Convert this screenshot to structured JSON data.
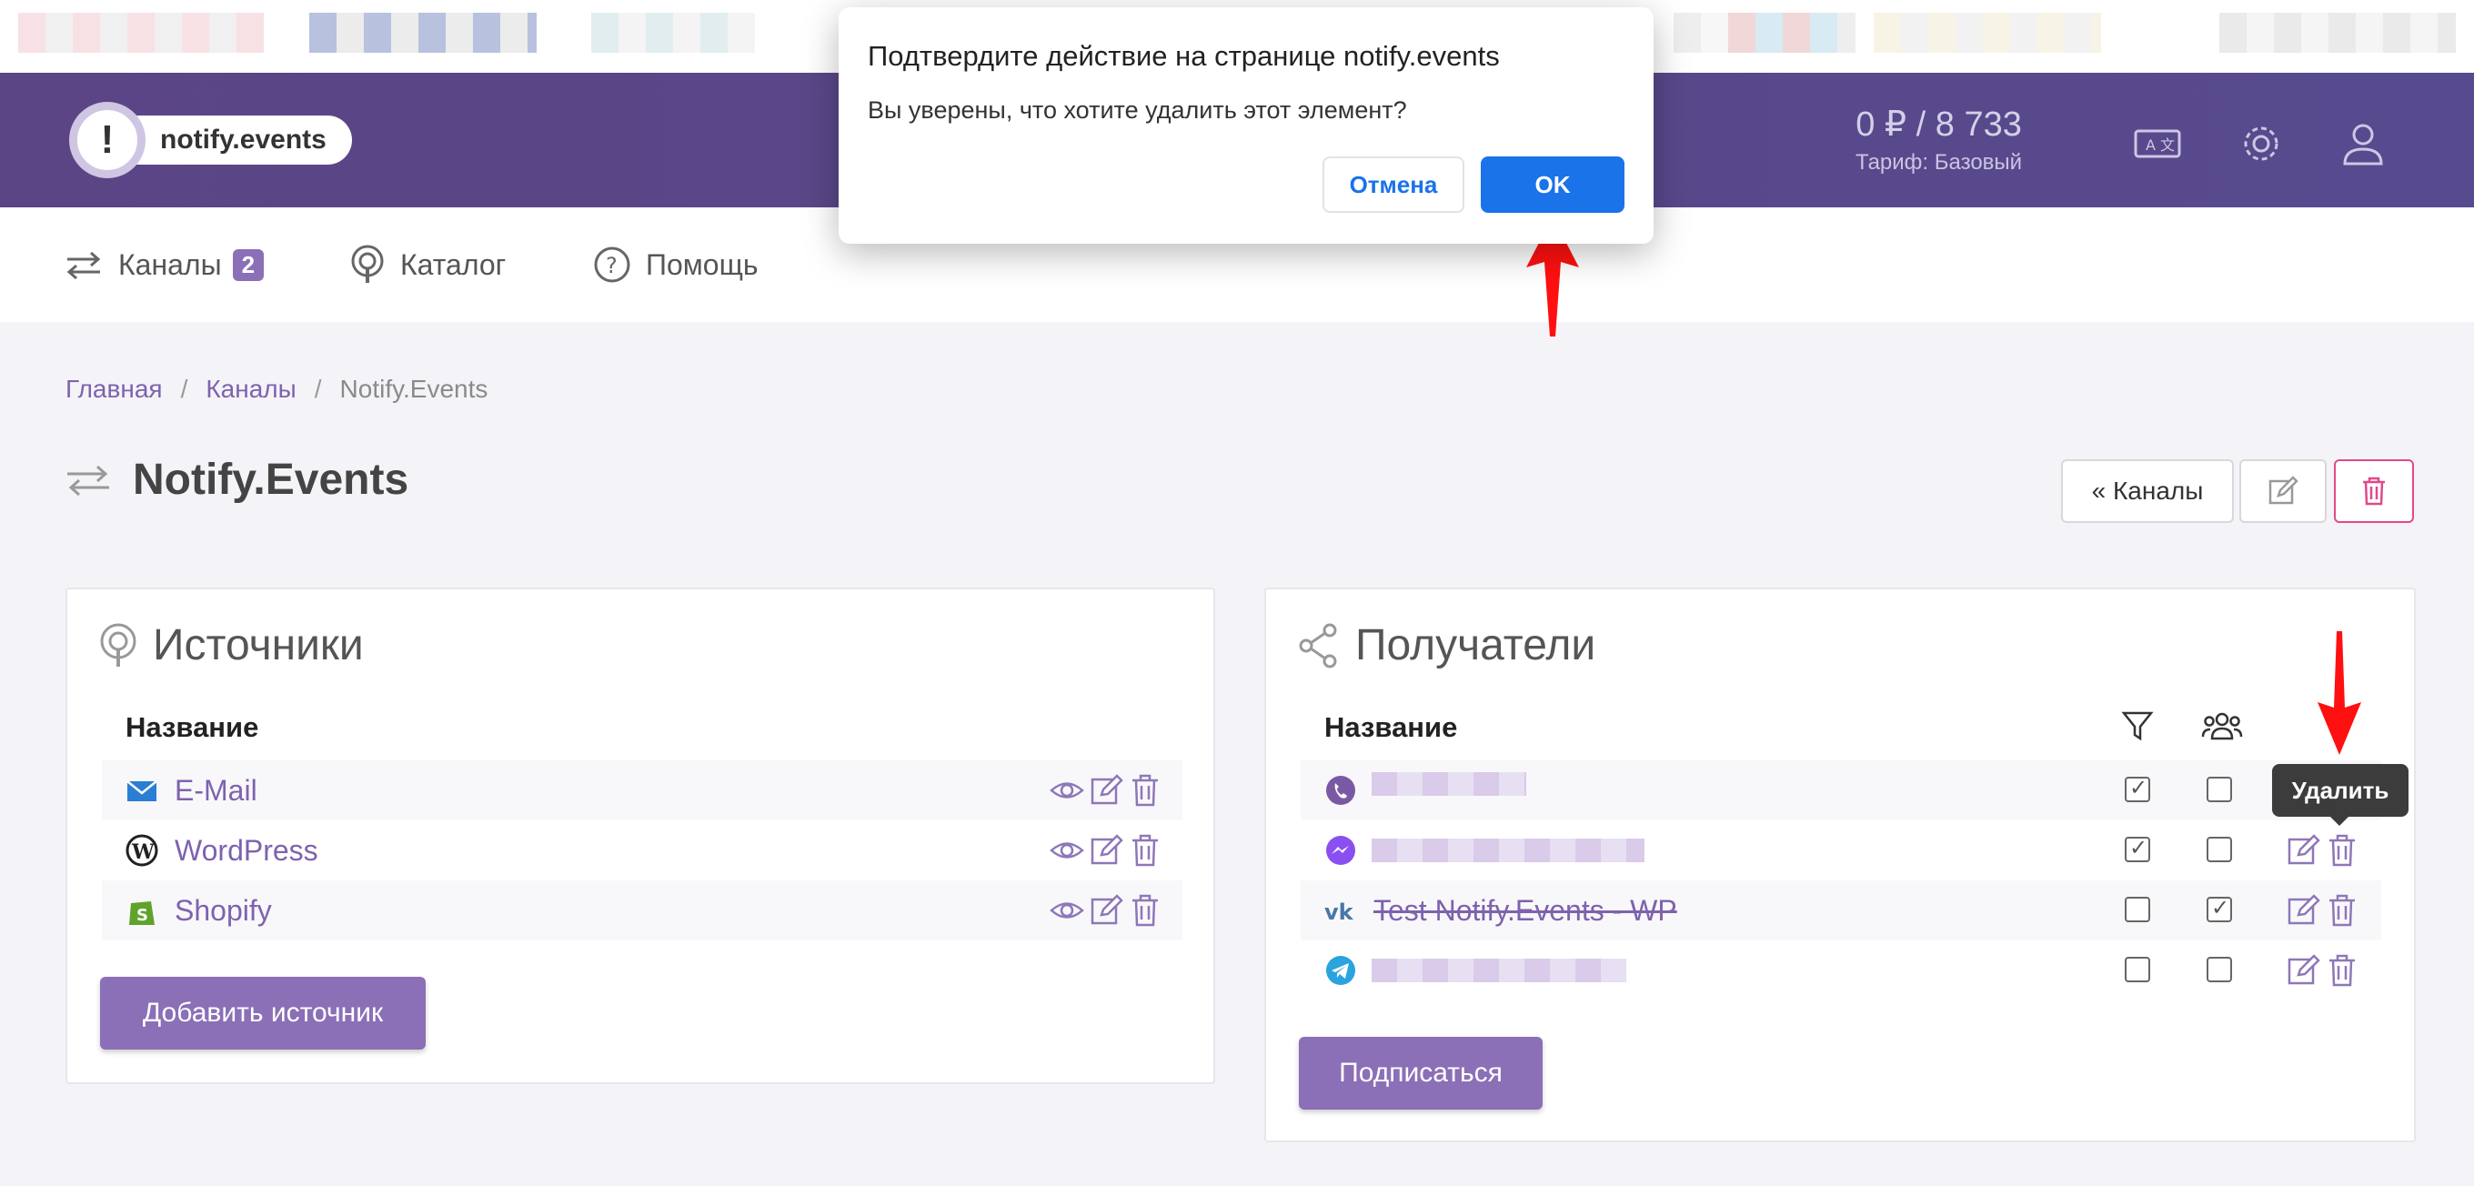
{
  "header": {
    "logo_mark": "!",
    "logo_text": "notify.events",
    "balance": "0 ₽ / 8 733",
    "tariff": "Тариф: Базовый"
  },
  "nav": {
    "channels": "Каналы",
    "channels_count": "2",
    "catalog": "Каталог",
    "help": "Помощь"
  },
  "breadcrumb": {
    "home": "Главная",
    "channels": "Каналы",
    "current": "Notify.Events",
    "separator": "/"
  },
  "page": {
    "title": "Notify.Events",
    "back_button": "« Каналы"
  },
  "sources": {
    "title": "Источники",
    "column_name": "Название",
    "rows": [
      {
        "label": "E-Mail",
        "icon": "email-icon"
      },
      {
        "label": "WordPress",
        "icon": "wordpress-icon"
      },
      {
        "label": "Shopify",
        "icon": "shopify-icon"
      }
    ],
    "add_button": "Добавить источник"
  },
  "recipients": {
    "title": "Получатели",
    "column_name": "Название",
    "rows": [
      {
        "label": "",
        "icon": "viber-icon",
        "filter": true,
        "group": false
      },
      {
        "label": "",
        "icon": "messenger-icon",
        "filter": true,
        "group": false
      },
      {
        "label": "Test Notify.Events - WP",
        "icon": "vk-icon",
        "filter": false,
        "group": true
      },
      {
        "label": "",
        "icon": "telegram-icon",
        "filter": false,
        "group": false
      }
    ],
    "subscribe_button": "Подписаться",
    "delete_tooltip": "Удалить"
  },
  "dialog": {
    "title": "Подтвердите действие на странице notify.events",
    "message": "Вы уверены, что хотите удалить этот элемент?",
    "cancel": "Отмена",
    "ok": "OK"
  },
  "colors": {
    "accent": "#8b6fb7",
    "header": "#5b4585",
    "link": "#7e62ae",
    "dialog_ok": "#1a73e8",
    "arrow": "#ff0000",
    "danger": "#e0498a"
  }
}
